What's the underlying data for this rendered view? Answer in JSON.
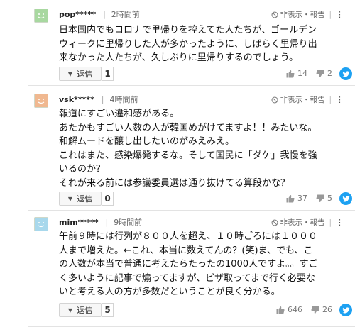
{
  "actions": {
    "hide_label": "非表示・報告",
    "reply_label": "返信"
  },
  "comments": [
    {
      "user": "pop*****",
      "time": "2時間前",
      "avatar_color": "#a8d8a0",
      "lines": [
        "日本国内でもコロナで里帰りを控えてた人たちが、ゴールデン",
        "ウィークに里帰りした人が多かったように、しばらく里帰り出",
        "来なかった人たちが、久しぶりに里帰りするのでしょう。"
      ],
      "replies": "1",
      "likes": "14",
      "dislikes": "2"
    },
    {
      "user": "vsk*****",
      "time": "4時間前",
      "avatar_color": "#f0b890",
      "lines": [
        "報道にすごい違和感がある。",
        "あたかもすごい人数の人が韓国めがけてますよ！！みたいな。",
        "和解ムードを醸し出したいのがみえみえ。",
        "これはまた、感染爆発するな。そして国民に「ダケ」我慢を強",
        "いるのか？",
        "それが来る前には参議委員選は通り抜けてる算段かな？"
      ],
      "replies": "0",
      "likes": "37",
      "dislikes": "5"
    },
    {
      "user": "mim*****",
      "time": "9時間前",
      "avatar_color": "#a8d8ec",
      "lines": [
        "午前９時には行列が８００人を超え、１０時ごろには１０００",
        "人まで増えた。←これ、本当に数えてんの？(笑)ま、でも、こ",
        "の人数が本当で普通に考えたらたったの1000人ですよ。。すご",
        "く多いように記事で煽ってますが、ビザ取ってまで行く必要な",
        "いと考える人の方が多数だということが良く分かる。"
      ],
      "replies": "5",
      "likes": "646",
      "dislikes": "26"
    }
  ]
}
